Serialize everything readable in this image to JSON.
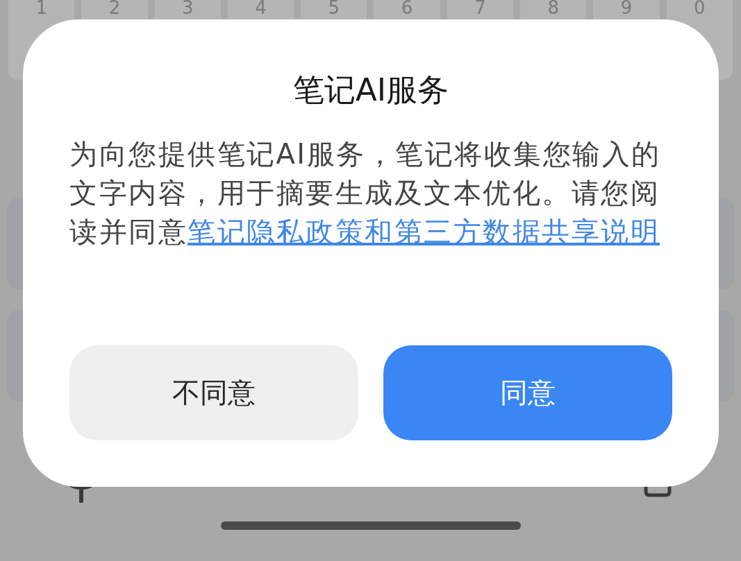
{
  "keyboard": {
    "digit_keys": [
      "1",
      "2",
      "3",
      "4",
      "5",
      "6",
      "7",
      "8",
      "9",
      "0"
    ]
  },
  "dialog": {
    "title": "笔记AI服务",
    "body": {
      "text": "为向您提供笔记AI服务，笔记将收集您输入的文字内容，用于摘要生成及文本优化。请您阅读并同意",
      "link": "笔记隐私政策和第三方数据共享说明"
    },
    "buttons": [
      {
        "label": "不同意",
        "kind": "secondary"
      },
      {
        "label": "同意",
        "kind": "primary"
      }
    ]
  }
}
